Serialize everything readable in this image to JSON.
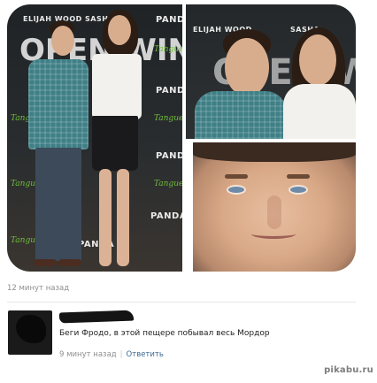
{
  "post": {
    "photo_alts": [
      "Elijah Wood and Sasha Grey at event",
      "Elijah Wood and Sasha Grey close-up",
      "Elijah Wood face close-up"
    ],
    "wall_texts": {
      "name1": "ELIJAH WOOD",
      "name2": "SASHA",
      "name3": "SASHA",
      "brand": "PANDA",
      "tanguero": "Tanguero",
      "title_logo": "OPEN WINDOWS"
    },
    "timestamp": "12 минут назад"
  },
  "comment": {
    "text": "Беги Фродо, в этой пещере побывал весь Мордор",
    "time": "9 минут назад",
    "separator": "|",
    "reply_label": "Ответить"
  },
  "watermark": "pikabu.ru"
}
